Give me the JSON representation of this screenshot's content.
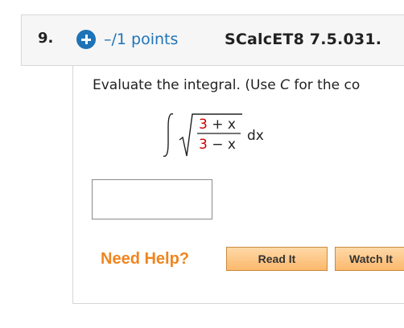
{
  "question": {
    "number": "9.",
    "points": "–/1 points",
    "code": "SCalcET8 7.5.031."
  },
  "problem": {
    "instruction_prefix": "Evaluate the integral. (Use ",
    "instruction_var": "C",
    "instruction_suffix": " for the co",
    "numerator_const": "3",
    "numerator_rest": " + x",
    "denominator_const": "3",
    "denominator_rest": " − x",
    "differential": "dx",
    "const_color": "#cc0000"
  },
  "help": {
    "label": "Need Help?",
    "read_it": "Read It",
    "watch_it": "Watch It"
  },
  "colors": {
    "accent": "#1f73b7",
    "help": "#f0851f",
    "button_fill": "#fbb86c"
  }
}
